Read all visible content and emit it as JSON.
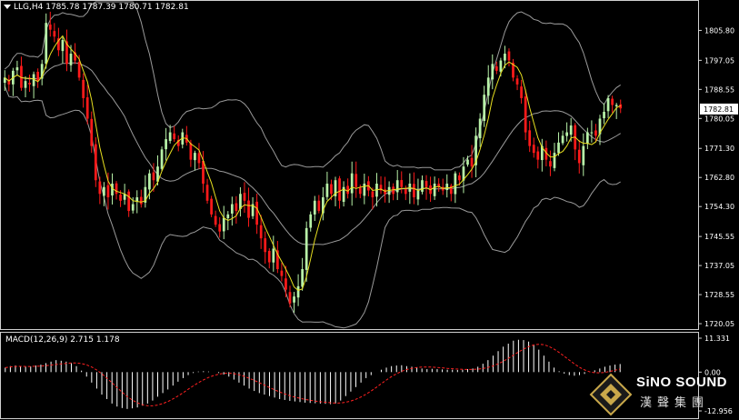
{
  "header": {
    "symbol": "LLG,H4",
    "ohlc": "1785.78 1787.39 1780.71 1782.81"
  },
  "price_axis": {
    "ticks": [
      "1805.80",
      "1797.05",
      "1788.55",
      "1780.05",
      "1771.30",
      "1762.80",
      "1754.30",
      "1745.55",
      "1737.05",
      "1728.55",
      "1720.05"
    ],
    "current_price": "1782.81"
  },
  "macd": {
    "label": "MACD(12,26,9) 2.715 1.178",
    "ticks": [
      "11.331",
      "0.00",
      "-12.956"
    ]
  },
  "logo": {
    "brand": "SiNO SOUND",
    "cn": "漢聲集團"
  },
  "colors": {
    "bull": "#b8f2a8",
    "bear": "#ff1a1a",
    "ma": "#e8e020",
    "bands": "#9a9a9a",
    "signal": "#ff2020",
    "hist": "#ffffff"
  },
  "chart_data": [
    {
      "type": "candlestick",
      "title": "LLG,H4",
      "ylim": [
        1719.0,
        1811.5
      ],
      "indicators": [
        "bollinger_bands",
        "moving_average"
      ],
      "grid": false,
      "closes": [
        1792,
        1790,
        1794,
        1795,
        1789,
        1791,
        1790,
        1793,
        1791,
        1796,
        1808,
        1806,
        1804,
        1800,
        1803,
        1796,
        1799,
        1797,
        1792,
        1786,
        1780,
        1772,
        1762,
        1758,
        1760,
        1757,
        1761,
        1758,
        1756,
        1758,
        1753,
        1755,
        1757,
        1755,
        1760,
        1764,
        1762,
        1766,
        1771,
        1774,
        1776,
        1774,
        1772,
        1776,
        1773,
        1768,
        1770,
        1767,
        1761,
        1756,
        1752,
        1749,
        1747,
        1751,
        1752,
        1755,
        1753,
        1758,
        1756,
        1751,
        1755,
        1749,
        1745,
        1741,
        1738,
        1742,
        1736,
        1734,
        1730,
        1726,
        1728,
        1731,
        1736,
        1748,
        1752,
        1756,
        1753,
        1757,
        1761,
        1758,
        1762,
        1756,
        1760,
        1758,
        1764,
        1760,
        1758,
        1761,
        1759,
        1757,
        1761,
        1759,
        1758,
        1760,
        1758,
        1762,
        1760,
        1758,
        1761,
        1757,
        1759,
        1762,
        1760,
        1758,
        1761,
        1760,
        1759,
        1761,
        1758,
        1764,
        1762,
        1766,
        1768,
        1766,
        1775,
        1780,
        1787,
        1792,
        1796,
        1794,
        1797,
        1799,
        1797,
        1792,
        1790,
        1786,
        1776,
        1772,
        1770,
        1768,
        1772,
        1768,
        1766,
        1770,
        1773,
        1775,
        1776,
        1778,
        1771,
        1767,
        1772,
        1776,
        1776,
        1775,
        1780,
        1782,
        1786,
        1784,
        1784,
        1783
      ]
    },
    {
      "type": "macd",
      "title": "MACD(12,26,9) 2.715 1.178",
      "ylim": [
        -12.956,
        11.331
      ],
      "histogram": [
        1.5,
        2.0,
        2.2,
        2.0,
        1.8,
        1.9,
        2.2,
        2.5,
        3.0,
        3.5,
        4.0,
        3.8,
        3.5,
        3.0,
        2.0,
        0.5,
        -1.5,
        -3.5,
        -5.5,
        -7.5,
        -9.0,
        -10.5,
        -11.5,
        -12.0,
        -12.3,
        -12.1,
        -11.8,
        -11.2,
        -10.5,
        -9.5,
        -8.2,
        -7.0,
        -5.8,
        -4.5,
        -3.2,
        -2.0,
        -1.0,
        -0.3,
        0.2,
        0.3,
        0.2,
        0.0,
        -0.3,
        -0.8,
        -1.5,
        -2.5,
        -3.5,
        -4.5,
        -5.5,
        -6.3,
        -7.0,
        -7.5,
        -8.0,
        -8.5,
        -9.0,
        -9.3,
        -9.6,
        -9.8,
        -10.0,
        -10.2,
        -10.3,
        -10.4,
        -10.5,
        -10.6,
        -10.7,
        -10.5,
        -9.5,
        -8.0,
        -6.5,
        -5.0,
        -3.5,
        -2.0,
        -1.0,
        0.0,
        0.8,
        1.5,
        2.0,
        2.2,
        2.3,
        2.0,
        1.8,
        1.5,
        1.2,
        1.0,
        1.1,
        1.0,
        0.9,
        0.8,
        0.8,
        0.7,
        0.8,
        1.0,
        1.2,
        1.8,
        2.8,
        4.0,
        5.5,
        7.0,
        8.5,
        9.5,
        10.5,
        10.8,
        10.7,
        10.2,
        9.0,
        7.5,
        5.5,
        3.5,
        1.5,
        0.3,
        -0.5,
        -1.0,
        -1.2,
        -1.0,
        -0.6,
        0.0,
        0.6,
        1.2,
        1.8,
        2.2,
        2.5,
        2.7
      ]
    }
  ]
}
